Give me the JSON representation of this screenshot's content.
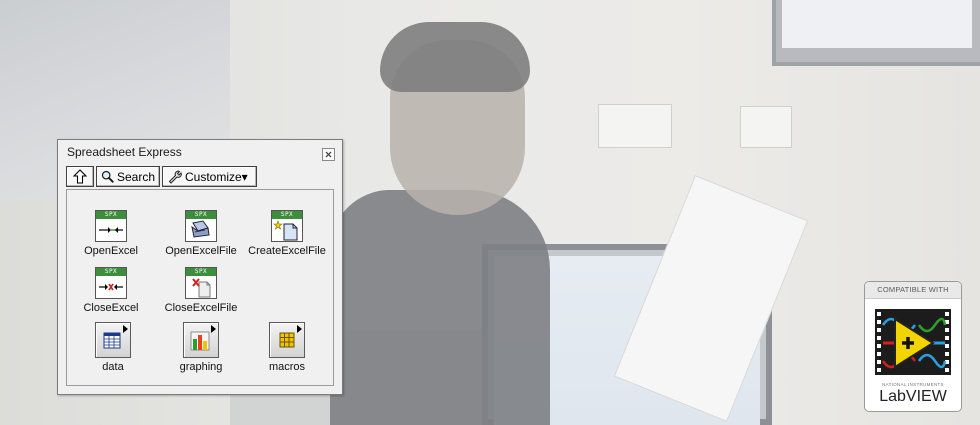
{
  "palette": {
    "title": "Spreadsheet Express",
    "toolbar": {
      "search_label": "Search",
      "customize_label": "Customize▾"
    },
    "vi_tag": "SPX",
    "items": [
      {
        "label": "OpenExcel",
        "icon": "open-excel-icon"
      },
      {
        "label": "OpenExcelFile",
        "icon": "open-excel-file-icon"
      },
      {
        "label": "CreateExcelFile",
        "icon": "create-excel-file-icon"
      },
      {
        "label": "CloseExcel",
        "icon": "close-excel-icon"
      },
      {
        "label": "CloseExcelFile",
        "icon": "close-excel-file-icon"
      },
      {
        "label": "data",
        "icon": "data-subpalette-icon"
      },
      {
        "label": "graphing",
        "icon": "graphing-subpalette-icon"
      },
      {
        "label": "macros",
        "icon": "macros-subpalette-icon"
      }
    ]
  },
  "badge": {
    "compatible_label": "COMPATIBLE WITH",
    "ni_label": "NATIONAL INSTRUMENTS",
    "product": "LabVIEW"
  },
  "colors": {
    "vi_header": "#3c8e3c",
    "wire_red": "#d22020",
    "badge_yellow": "#f2d400"
  }
}
